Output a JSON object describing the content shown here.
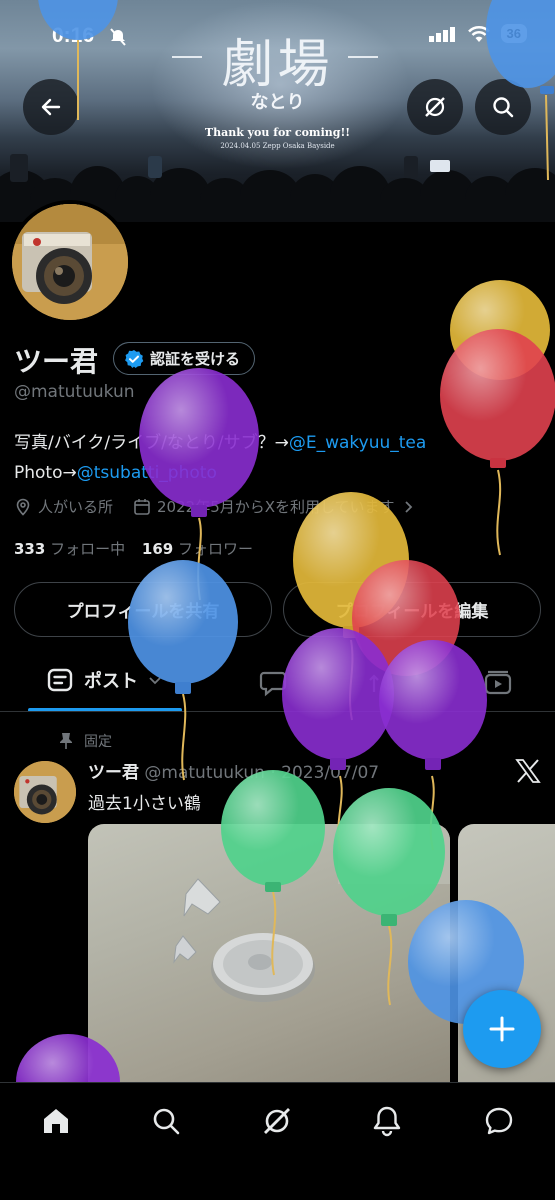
{
  "status_bar": {
    "time": "0:16",
    "battery": "36"
  },
  "banner": {
    "title": "劇場",
    "subtitle": "なとり",
    "thanks": "Thank you for coming!!",
    "date": "2024.04.05 Zepp Osaka Bayside"
  },
  "profile": {
    "name": "ツー君",
    "verify_label": "認証を受ける",
    "handle": "@matutuukun",
    "bio_line1_prefix": "写真/バイク/ライブ/なとり/サブ？→",
    "bio_line1_link": "@E_wakyuu_tea",
    "bio_line2_prefix": "Photo→",
    "bio_line2_link": "@tsubatti_photo",
    "location": "人がいる所",
    "joined": "2022年5月からXを利用しています",
    "following_count": "333",
    "following_label": "フォロー中",
    "followers_count": "169",
    "followers_label": "フォロワー",
    "share_button": "プロフィールを共有",
    "edit_button": "プロフィールを編集"
  },
  "tabs": {
    "active_label": "ポスト"
  },
  "post": {
    "pinned_label": "固定",
    "author_name": "ツー君",
    "author_handle": "@matutuukun",
    "date": "2023/07/07",
    "text": "過去1小さい鶴"
  },
  "colors": {
    "accent": "#1d9bf0",
    "background": "#000000",
    "muted": "#71767b"
  },
  "icons": [
    "back-arrow-icon",
    "grok-icon",
    "search-icon",
    "verified-badge-icon",
    "location-icon",
    "calendar-icon",
    "chevron-right-icon",
    "post-tab-icon",
    "chevron-down-icon",
    "reply-tab-icon",
    "repost-tab-icon",
    "media-tab-icon",
    "pin-icon",
    "x-logo-icon",
    "compose-plus-icon",
    "home-icon",
    "explore-icon",
    "notifications-icon",
    "messages-icon"
  ]
}
